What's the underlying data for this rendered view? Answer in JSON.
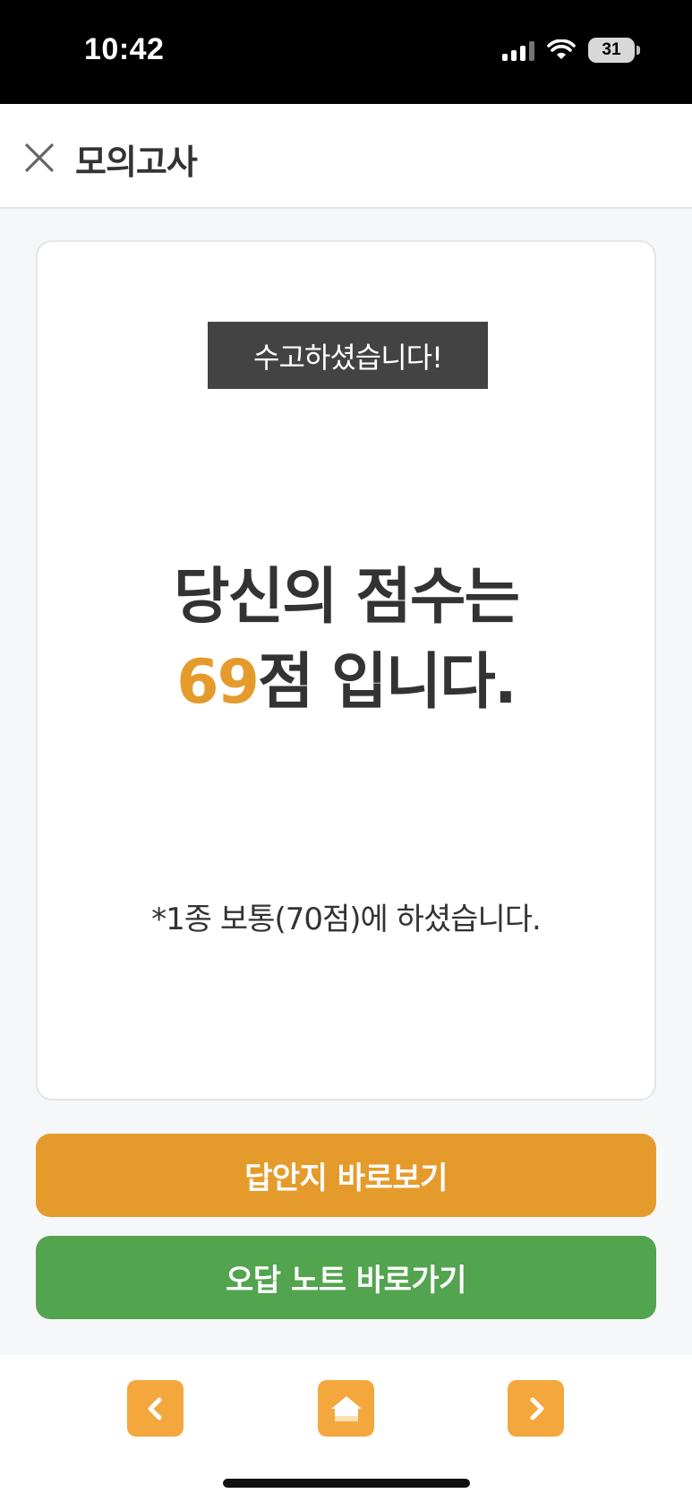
{
  "status_bar": {
    "time": "10:42",
    "battery": "31"
  },
  "header": {
    "title": "모의고사"
  },
  "result": {
    "badge": "수고하셨습니다!",
    "line1": "당신의 점수는",
    "score": "69",
    "score_suffix": "점 입니다.",
    "note": "*1종 보통(70점)에 하셨습니다."
  },
  "actions": {
    "answer_sheet": "답안지 바로보기",
    "wrong_note": "오답 노트 바로가기"
  },
  "colors": {
    "accent_orange": "#e59b2c",
    "accent_green": "#52a44e",
    "nav_orange": "#f3a73c",
    "badge_dark": "#434343"
  }
}
